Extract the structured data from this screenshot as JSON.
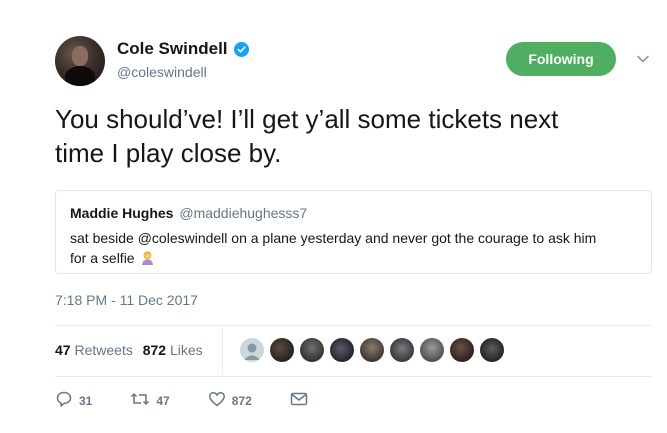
{
  "author": {
    "name": "Cole Swindell",
    "handle": "@coleswindell",
    "verified": true
  },
  "follow_button": {
    "label": "Following",
    "color": "#4fae62"
  },
  "tweet": {
    "line1": "You should’ve! I’ll get y’all some tickets next",
    "line2": "time I play close by."
  },
  "quoted": {
    "name": "Maddie Hughes",
    "handle": "@maddiehughesss7",
    "line1": "sat beside @coleswindell on a plane yesterday and never got the courage to ask him",
    "line2": "for a selfie",
    "emoji": "woman-facepalming-icon"
  },
  "timestamp": "7:18 PM - 11 Dec 2017",
  "stats": {
    "retweets_count": "47",
    "retweets_label": "Retweets",
    "likes_count": "872",
    "likes_label": "Likes"
  },
  "likers": [
    "liker-1",
    "liker-2",
    "liker-3",
    "liker-4",
    "liker-5",
    "liker-6",
    "liker-7",
    "liker-8",
    "liker-9",
    "liker-10"
  ],
  "actions": {
    "reply_count": "31",
    "retweet_count": "47",
    "like_count": "872"
  },
  "colors": {
    "accent_blue": "#1da1f2",
    "muted_text": "#657786",
    "border": "#e1e8ed"
  }
}
